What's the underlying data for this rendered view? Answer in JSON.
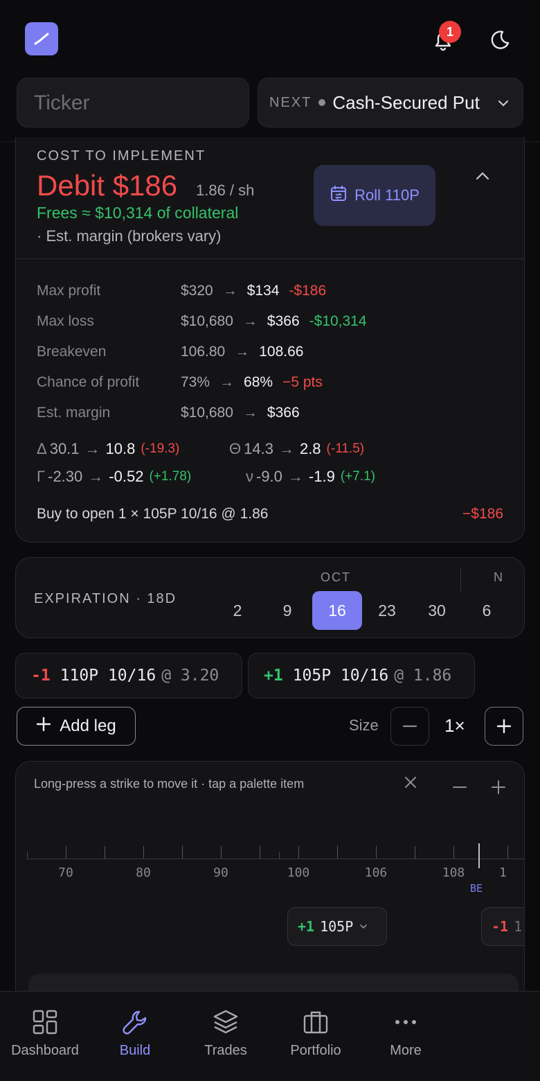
{
  "header": {
    "notification_count": "1",
    "ticker_placeholder": "Ticker",
    "strategy": {
      "next_label": "NEXT",
      "name": "Cash-Secured Put"
    }
  },
  "cost": {
    "label": "COST TO IMPLEMENT",
    "debit": "Debit $186",
    "per_share": "1.86 / sh",
    "frees": "Frees ≈ $10,314 of collateral",
    "est_margin": "· Est. margin (brokers vary)",
    "roll_button": "Roll 110P"
  },
  "metrics": [
    {
      "label": "Max profit",
      "from": "$320",
      "to": "$134",
      "delta": "-$186",
      "tone": "neg"
    },
    {
      "label": "Max loss",
      "from": "$10,680",
      "to": "$366",
      "delta": "-$10,314",
      "tone": "pos"
    },
    {
      "label": "Breakeven",
      "from": "106.80",
      "to": "108.66",
      "delta": "",
      "tone": ""
    },
    {
      "label": "Chance of profit",
      "from": "73%",
      "to": "68%",
      "delta": "−5 pts",
      "tone": "neg"
    },
    {
      "label": "Est. margin",
      "from": "$10,680",
      "to": "$366",
      "delta": "",
      "tone": ""
    }
  ],
  "greeks": {
    "delta": {
      "sym": "Δ",
      "from": "30.1",
      "to": "10.8",
      "diff": "(-19.3)",
      "tone": "neg"
    },
    "theta": {
      "sym": "Θ",
      "from": "14.3",
      "to": "2.8",
      "diff": "(-11.5)",
      "tone": "neg"
    },
    "gamma": {
      "sym": "Γ",
      "from": "-2.30",
      "to": "-0.52",
      "diff": "(+1.78)",
      "tone": "pos"
    },
    "vega": {
      "sym": "ν",
      "from": "-9.0",
      "to": "-1.9",
      "diff": "(+7.1)",
      "tone": "pos"
    }
  },
  "order": {
    "text": "Buy to open 1 × 105P 10/16 @ 1.86",
    "amount": "−$186"
  },
  "expiration": {
    "label": "EXPIRATION · 18D",
    "month_current": "OCT",
    "month_next": "N",
    "days": [
      "2",
      "9",
      "16",
      "23",
      "30",
      "6"
    ],
    "selected": "16"
  },
  "legs": [
    {
      "qty": "-1",
      "strike": "110P 10/16",
      "price": "@ 3.20",
      "tone": "neg"
    },
    {
      "qty": "+1",
      "strike": "105P 10/16",
      "price": "@ 1.86",
      "tone": "pos"
    }
  ],
  "controls": {
    "add_leg": "Add leg",
    "size_label": "Size",
    "size_value": "1×"
  },
  "ladder": {
    "hint": "Long-press a strike to move it · tap a palette item",
    "ticks": [
      "70",
      "80",
      "90",
      "100",
      "106",
      "108",
      "1"
    ],
    "be_label": "BE",
    "chips": [
      {
        "qty": "+1",
        "strike": "105P",
        "tone": "pos"
      },
      {
        "qty": "-1",
        "strike": "1",
        "tone": "neg"
      }
    ]
  },
  "nav": {
    "items": [
      "Dashboard",
      "Build",
      "Trades",
      "Portfolio",
      "More"
    ],
    "active": "Build"
  },
  "colors": {
    "accent": "#7b7cf0",
    "negative": "#f24a4a",
    "positive": "#34c26a",
    "background": "#0b0b0d"
  }
}
